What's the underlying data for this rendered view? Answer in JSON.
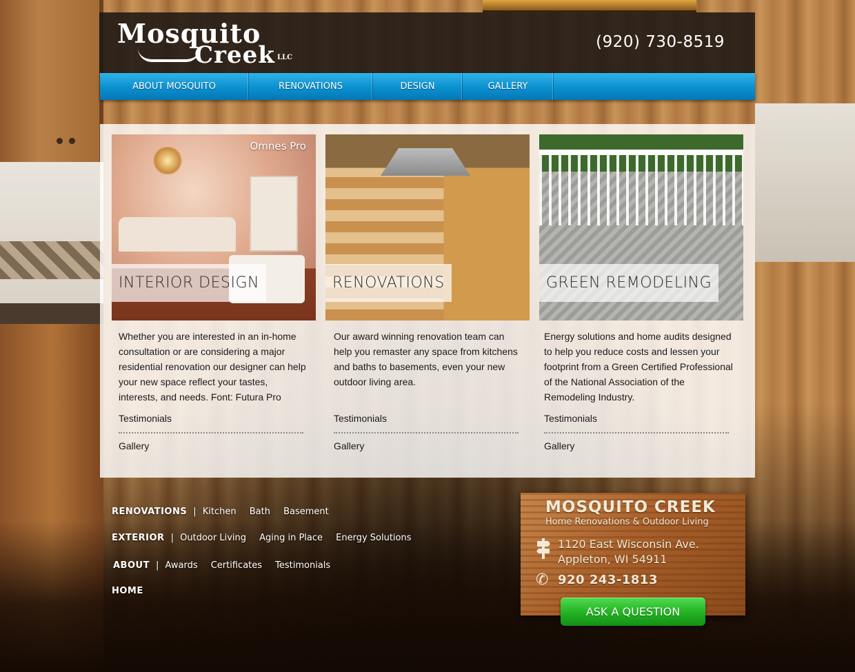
{
  "header": {
    "logo_line1": "Mosquito",
    "logo_line2": "Creek",
    "logo_llc": "LLC",
    "phone": "(920) 730-8519"
  },
  "nav": {
    "items": [
      {
        "label": "ABOUT MOSQUITO"
      },
      {
        "label": "RENOVATIONS"
      },
      {
        "label": "DESIGN"
      },
      {
        "label": "GALLERY"
      }
    ]
  },
  "cards": [
    {
      "title": "INTERIOR DESIGN",
      "image_caption": "Omnes Pro",
      "description": "Whether you are interested in an in-home consultation or are considering a major residential renovation our designer can help your new space reflect your tastes, interests, and needs. Font: Futura Pro",
      "link1": "Testimonials",
      "link2": "Gallery"
    },
    {
      "title": "RENOVATIONS",
      "description": "Our award winning renovation team can help you remaster any space from kitchens and baths to basements, even your new outdoor living area.",
      "link1": "Testimonials",
      "link2": "Gallery"
    },
    {
      "title": "GREEN REMODELING",
      "description": "Energy solutions and home audits designed to help you reduce costs and lessen your footprint from a Green Certified Professional of the National Association of the Remodeling Industry.",
      "link1": "Testimonials",
      "link2": "Gallery"
    }
  ],
  "footer": {
    "renovations": {
      "head": "RENOVATIONS",
      "links": [
        "Kitchen",
        "Bath",
        "Basement"
      ]
    },
    "exterior": {
      "head": "EXTERIOR",
      "links": [
        "Outdoor Living",
        "Aging in Place",
        "Energy Solutions"
      ]
    },
    "about": {
      "head": "ABOUT",
      "links": [
        "Awards",
        "Certificates",
        "Testimonials"
      ]
    },
    "home": {
      "head": "HOME"
    },
    "separator": "|"
  },
  "contact": {
    "title": "MOSQUITO CREEK",
    "subtitle": "Home Renovations & Outdoor Living",
    "address_line1": "1120 East Wisconsin Ave.",
    "address_line2": "Appleton, WI 54911",
    "phone": "920 243-1813",
    "button": "ASK A QUESTION"
  },
  "icons": {
    "signpost": "signpost-icon",
    "phone": "phone-icon"
  },
  "colors": {
    "nav_blue": "#0a90cf",
    "button_green": "#22b122",
    "header_dark": "#1e1814"
  }
}
